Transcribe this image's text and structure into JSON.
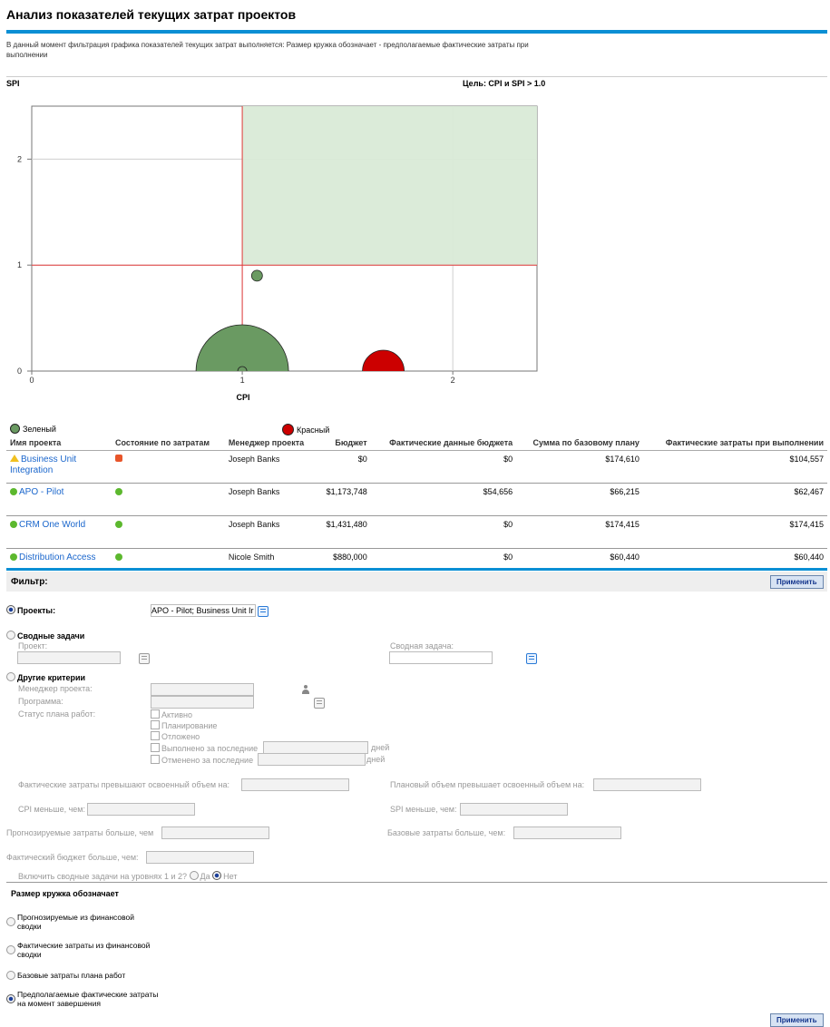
{
  "page": {
    "title": "Анализ показателей текущих затрат проектов",
    "filter_description": "В данный момент фильтрация графика показателей текущих затрат выполняется: Размер кружка обозначает - предполагаемые фактические затраты при выполнении"
  },
  "chart_data": {
    "type": "scatter",
    "title": "",
    "goal_label": "Цель: CPI и SPI > 1.0",
    "xlabel": "CPI",
    "ylabel": "SPI",
    "xlim": [
      0,
      2.4
    ],
    "ylim": [
      0,
      2.5
    ],
    "xticks": [
      "0",
      "1",
      "2"
    ],
    "yticks": [
      "0",
      "1",
      "2"
    ],
    "target_region": {
      "x_from": 1.0,
      "y_from": 1.0,
      "color": "#d9ead7"
    },
    "reference_lines": {
      "x": 1.0,
      "y": 1.0,
      "color": "#e23a3a"
    },
    "grid": true,
    "legend": [
      {
        "label": "Зеленый",
        "color": "#6a9a62"
      },
      {
        "label": "Красный",
        "color": "#cc0000"
      }
    ],
    "points": [
      {
        "cpi": 1.07,
        "spi": 0.9,
        "size": 62467,
        "color": "#6a9a62"
      },
      {
        "cpi": 1.0,
        "spi": 0.0,
        "size": 174415,
        "color": "#6a9a62"
      },
      {
        "cpi": 1.0,
        "spi": 0.0,
        "size": 60440,
        "color": "#6a9a62"
      },
      {
        "cpi": 1.67,
        "spi": 0.0,
        "size": 104557,
        "color": "#cc0000"
      }
    ]
  },
  "table": {
    "headers": [
      "Имя проекта",
      "Состояние по затратам",
      "Менеджер проекта",
      "Бюджет",
      "Фактические данные бюджета",
      "Сумма по базовому плану",
      "Фактические затраты при выполнении"
    ],
    "rows": [
      {
        "name": "Business Unit Integration",
        "name_icon": "warning-triangle-icon",
        "status": "red",
        "manager": "Joseph Banks",
        "budget": "$0",
        "actual_budget": "$0",
        "baseline": "$174,610",
        "actual_cost": "$104,557"
      },
      {
        "name": "APO - Pilot",
        "name_icon": "green-dot-icon",
        "status": "green",
        "manager": "Joseph Banks",
        "budget": "$1,173,748",
        "actual_budget": "$54,656",
        "baseline": "$66,215",
        "actual_cost": "$62,467"
      },
      {
        "name": "CRM One World",
        "name_icon": "green-dot-icon",
        "status": "green",
        "manager": "Joseph Banks",
        "budget": "$1,431,480",
        "actual_budget": "$0",
        "baseline": "$174,415",
        "actual_cost": "$174,415"
      },
      {
        "name": "Distribution Access",
        "name_icon": "green-dot-icon",
        "status": "green",
        "manager": "Nicole Smith",
        "budget": "$880,000",
        "actual_budget": "$0",
        "baseline": "$60,440",
        "actual_cost": "$60,440"
      }
    ]
  },
  "filter": {
    "title": "Фильтр:",
    "apply_label": "Применить",
    "projects_label": "Проекты:",
    "projects_value": "APO - Pilot; Business Unit Ir",
    "summary_tasks_label": "Сводные задачи",
    "project_label": "Проект:",
    "summary_task_label": "Сводная задача:",
    "other_label": "Другие критерии",
    "pm_label": "Менеджер проекта:",
    "program_label": "Программа:",
    "wp_status_label": "Статус плана работ:",
    "statuses": [
      "Активно",
      "Планирование",
      "Отложено"
    ],
    "completed_label": "Выполнено за последние",
    "cancelled_label": "Отменено за последние",
    "days_label": "дней",
    "actual_exceeds_label": "Фактические затраты превышают освоенный объем на:",
    "planned_exceeds_label": "Плановый объем превышает освоенный объем на:",
    "cpi_less_label": "CPI меньше, чем:",
    "spi_less_label": "SPI меньше, чем:",
    "forecast_more_label": "Прогнозируемые затраты больше, чем",
    "baseline_more_label": "Базовые затраты больше, чем:",
    "actual_budget_more_label": "Фактический бюджет больше, чем:",
    "include_label": "Включить сводные задачи на уровнях 1 и 2?",
    "yes_label": "Да",
    "no_label": "Нет",
    "bubble_size_label": "Размер кружка обозначает",
    "bubble_options": [
      "Прогнозируемые из финансовой сводки",
      "Фактические затраты из финансовой сводки",
      "Базовые затраты плана работ",
      "Предполагаемые фактические затраты на момент завершения"
    ]
  }
}
